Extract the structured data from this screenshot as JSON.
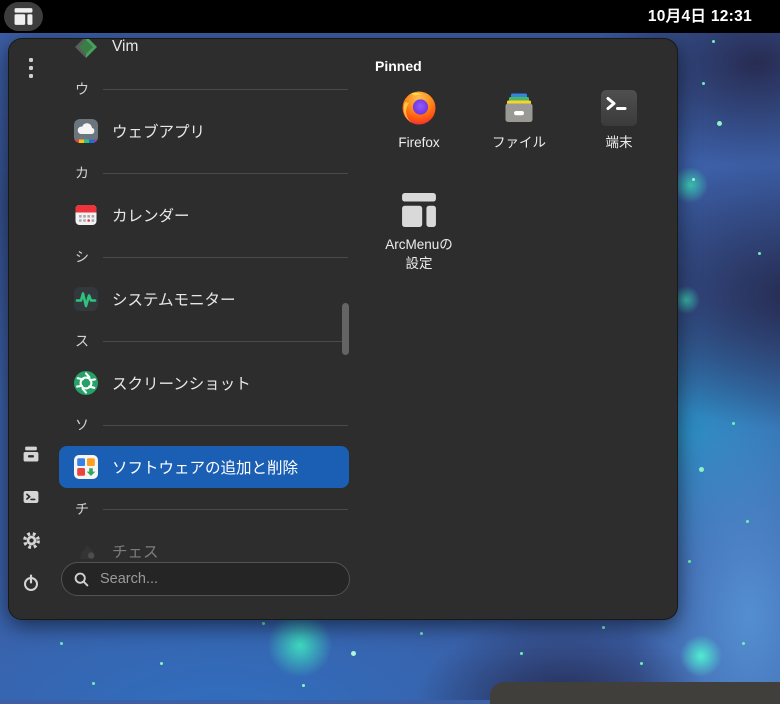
{
  "topbar": {
    "clock": "10月4日 12:31"
  },
  "menu": {
    "app_list": {
      "items": [
        {
          "type": "app",
          "id": "vim",
          "label": "Vim"
        },
        {
          "type": "section",
          "label": "ウ"
        },
        {
          "type": "app",
          "id": "web-apps",
          "label": "ウェブアプリ"
        },
        {
          "type": "section",
          "label": "カ"
        },
        {
          "type": "app",
          "id": "calendar",
          "label": "カレンダー"
        },
        {
          "type": "section",
          "label": "シ"
        },
        {
          "type": "app",
          "id": "system-monitor",
          "label": "システムモニター"
        },
        {
          "type": "section",
          "label": "ス"
        },
        {
          "type": "app",
          "id": "screenshot",
          "label": "スクリーンショット"
        },
        {
          "type": "section",
          "label": "ソ"
        },
        {
          "type": "app",
          "id": "software",
          "label": "ソフトウェアの追加と削除",
          "selected": true
        },
        {
          "type": "section",
          "label": "チ"
        },
        {
          "type": "app",
          "id": "chess",
          "label": "チェス",
          "faded": true
        }
      ]
    },
    "pinned": {
      "title": "Pinned",
      "items": [
        {
          "label": "Firefox"
        },
        {
          "label": "ファイル"
        },
        {
          "label": "端末"
        },
        {
          "label": "ArcMenuの設定"
        }
      ]
    },
    "search": {
      "placeholder": "Search..."
    }
  },
  "icons": {
    "panel_button": "arcmenu-layout-icon",
    "sidebar": [
      "file-drawer-icon",
      "terminal-icon",
      "gear-icon",
      "power-icon"
    ],
    "search": "magnifier-icon"
  },
  "colors": {
    "accent_selected": "#1b5fb5",
    "menu_background": "#2d2d2d",
    "topbar_background": "#000000"
  }
}
